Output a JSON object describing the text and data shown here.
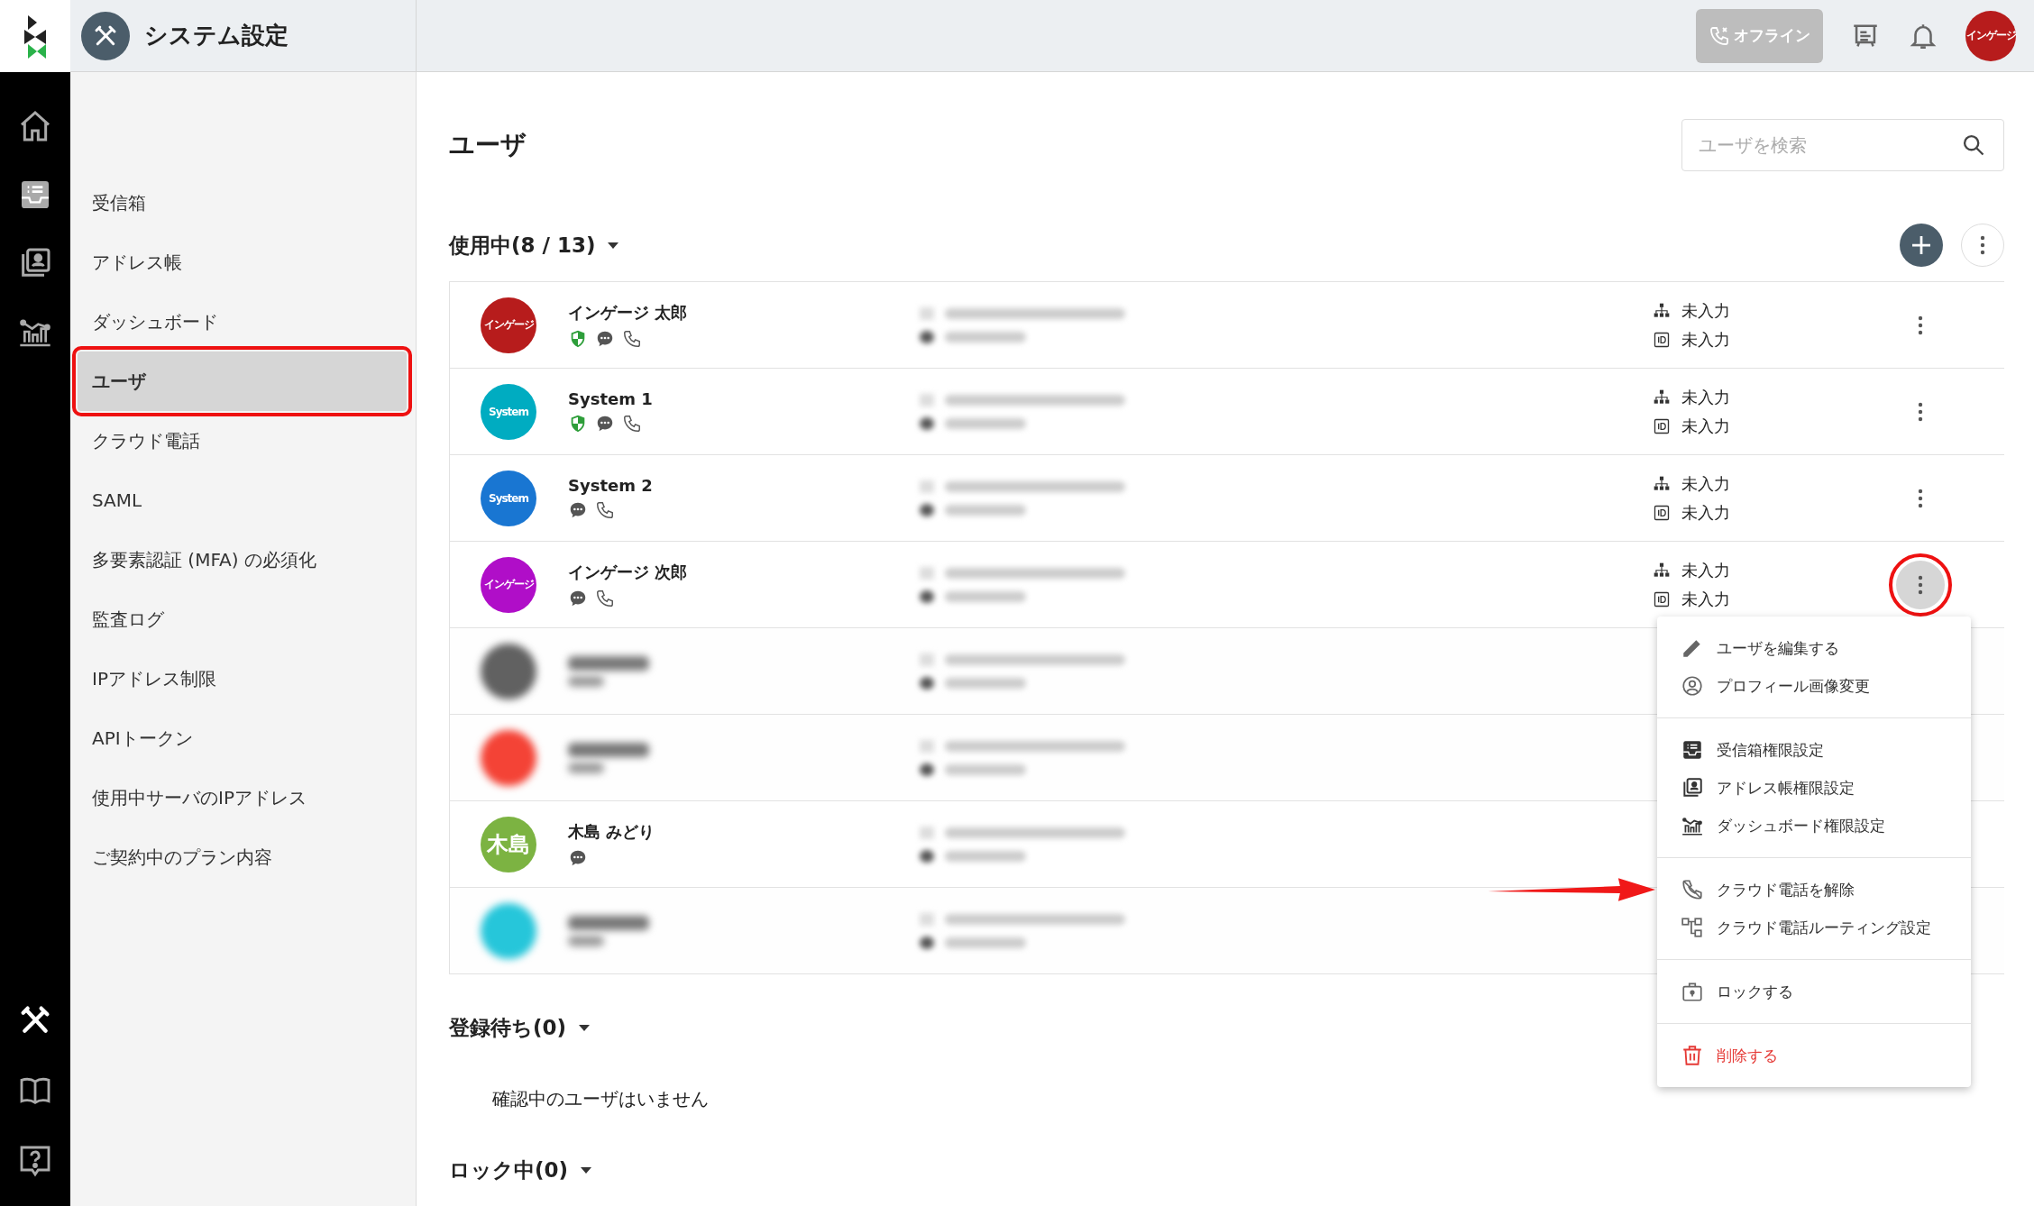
{
  "header": {
    "title": "システム設定",
    "status_button": "オフライン",
    "avatar": "インゲージ"
  },
  "rail": {
    "top": [
      {
        "kind": "home",
        "selected": false
      },
      {
        "kind": "inbox",
        "selected": false
      },
      {
        "kind": "contacts",
        "selected": false
      },
      {
        "kind": "dashboard",
        "selected": false
      }
    ],
    "bottom": [
      {
        "kind": "tools",
        "selected": true
      },
      {
        "kind": "book",
        "selected": false
      },
      {
        "kind": "help",
        "selected": false
      }
    ]
  },
  "sidebar": {
    "items": [
      {
        "label": "受信箱",
        "selected": false
      },
      {
        "label": "アドレス帳",
        "selected": false
      },
      {
        "label": "ダッシュボード",
        "selected": false
      },
      {
        "label": "ユーザ",
        "selected": true
      },
      {
        "label": "クラウド電話",
        "selected": false
      },
      {
        "label": "SAML",
        "selected": false
      },
      {
        "label": "多要素認証 (MFA) の必須化",
        "selected": false
      },
      {
        "label": "監査ログ",
        "selected": false
      },
      {
        "label": "IPアドレス制限",
        "selected": false
      },
      {
        "label": "APIトークン",
        "selected": false
      },
      {
        "label": "使用中サーバのIPアドレス",
        "selected": false
      },
      {
        "label": "ご契約中のプラン内容",
        "selected": false
      }
    ]
  },
  "page": {
    "title": "ユーザ",
    "search": {
      "placeholder": "ユーザを検索"
    }
  },
  "active_section": {
    "title": "使用中(8 / 13)",
    "expanded": true
  },
  "users": [
    {
      "name": "インゲージ 太郎",
      "avatar": "インゲージ",
      "color": "#b71c1c",
      "redacted": false,
      "badges": [
        {
          "kind": "shield"
        },
        {
          "kind": "chat"
        },
        {
          "kind": "phone"
        }
      ],
      "department": "未入力",
      "employee_id": "未入力",
      "menu_open": false
    },
    {
      "name": "System 1",
      "avatar": "System",
      "color": "#00acc1",
      "redacted": false,
      "badges": [
        {
          "kind": "shield"
        },
        {
          "kind": "chat"
        },
        {
          "kind": "phone"
        }
      ],
      "department": "未入力",
      "employee_id": "未入力",
      "menu_open": false
    },
    {
      "name": "System 2",
      "avatar": "System",
      "color": "#1976d2",
      "redacted": false,
      "badges": [
        {
          "kind": "chat"
        },
        {
          "kind": "phone"
        }
      ],
      "department": "未入力",
      "employee_id": "未入力",
      "menu_open": false
    },
    {
      "name": "インゲージ 次郎",
      "avatar": "インゲージ",
      "color": "#b00ec8",
      "redacted": false,
      "badges": [
        {
          "kind": "chat"
        },
        {
          "kind": "phone"
        }
      ],
      "department": "未入力",
      "employee_id": "未入力",
      "menu_open": true
    },
    {
      "color": "#616161",
      "redacted": true
    },
    {
      "color": "#f44336",
      "redacted": true
    },
    {
      "name": "木島 みどり",
      "avatar": "木島",
      "color": "#7cb342",
      "redacted": false,
      "badges": [
        {
          "kind": "chat"
        }
      ]
    },
    {
      "color": "#26c6da",
      "redacted": true
    }
  ],
  "row_menu": {
    "groups": [
      [
        {
          "kind": "pencil",
          "label": "ユーザを編集する",
          "danger": false,
          "pointed": false
        },
        {
          "kind": "profile",
          "label": "プロフィール画像変更",
          "danger": false,
          "pointed": false
        }
      ],
      [
        {
          "kind": "inbox",
          "label": "受信箱権限設定",
          "danger": false,
          "pointed": false
        },
        {
          "kind": "contacts",
          "label": "アドレス帳権限設定",
          "danger": false,
          "pointed": false
        },
        {
          "kind": "dashboard",
          "label": "ダッシュボード権限設定",
          "danger": false,
          "pointed": false
        }
      ],
      [
        {
          "kind": "phone-off",
          "label": "クラウド電話を解除",
          "danger": false,
          "pointed": true
        },
        {
          "kind": "routing",
          "label": "クラウド電話ルーティング設定",
          "danger": false,
          "pointed": false
        }
      ],
      [
        {
          "kind": "lock",
          "label": "ロックする",
          "danger": false,
          "pointed": false
        }
      ],
      [
        {
          "kind": "trash",
          "label": "削除する",
          "danger": true,
          "pointed": false
        }
      ]
    ]
  },
  "pending_section": {
    "title": "登録待ち(0)",
    "expanded": true,
    "empty_text": "確認中のユーザはいません"
  },
  "locked_section": {
    "title": "ロック中(0)",
    "expanded": true
  }
}
